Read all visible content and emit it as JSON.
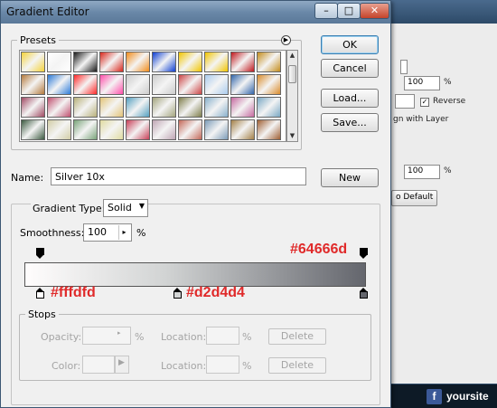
{
  "background_app": {
    "field_value_1": "100",
    "field_value_1_unit": "%",
    "reverse_label": "Reverse",
    "align_label": "gn with Layer",
    "field_value_2": "100",
    "field_value_2_unit": "%",
    "reset_button": "o Default",
    "site_label": "yoursite",
    "facebook_icon_glyph": "f"
  },
  "window": {
    "title": "Gradient Editor",
    "minimize_glyph": "–",
    "maximize_glyph": "□",
    "close_glyph": "✕"
  },
  "presets": {
    "label": "Presets",
    "menu_icon_glyph": "▶",
    "swatches": [
      [
        "#f5d23a",
        "#ffffff",
        "#1b1b1b",
        "#d8281d",
        "#f28c1a",
        "#0f3fd2",
        "#f2c500",
        "#f2c500",
        "#c0191e",
        "#c48d1d"
      ],
      [
        "#b47a3c",
        "#2e7bd8",
        "#ff2a2a",
        "#ff4eaa",
        "#cccccc",
        "#cccccc",
        "#cc4444",
        "#aaccee",
        "#3366aa",
        "#d98c2c"
      ],
      [
        "#a04a63",
        "#c0506f",
        "#b8b07a",
        "#e3c477",
        "#54a0c0",
        "#a4a57e",
        "#7f7e4c",
        "#88b0cc",
        "#c66aa0",
        "#7aa8c4"
      ],
      [
        "#3c5a40",
        "#d2cda6",
        "#7aa47a",
        "#e0dba0",
        "#c84058",
        "#c0a6b4",
        "#c46858",
        "#7c9cb8",
        "#a48048",
        "#a06034"
      ]
    ],
    "scroll_up_glyph": "▲",
    "scroll_down_glyph": "▼"
  },
  "buttons": {
    "ok": "OK",
    "cancel": "Cancel",
    "load": "Load...",
    "save": "Save...",
    "new": "New"
  },
  "name": {
    "label": "Name:",
    "value": "Silver 10x"
  },
  "gradient": {
    "type_label": "Gradient Type:",
    "type_value": "Solid",
    "type_arrow": "▼",
    "smoothness_label": "Smoothness:",
    "smoothness_value": "100",
    "smoothness_arrow": "▸",
    "smoothness_unit": "%",
    "bar_colors": [
      "#fffdfd",
      "#d2d4d4",
      "#64666d"
    ],
    "color_stops": [
      {
        "color": "#fffdfd",
        "location_pct": 0
      },
      {
        "color": "#d2d4d4",
        "location_pct": 41
      },
      {
        "color": "#64666d",
        "location_pct": 100
      }
    ],
    "annotations": {
      "dark": "#64666d",
      "white": "#fffdfd",
      "mid": "#d2d4d4"
    }
  },
  "stops": {
    "label": "Stops",
    "opacity_label": "Opacity:",
    "opacity_arrow": "▸",
    "percent": "%",
    "location_label": "Location:",
    "delete_label": "Delete",
    "color_label": "Color:",
    "color_arrow": "▶"
  }
}
